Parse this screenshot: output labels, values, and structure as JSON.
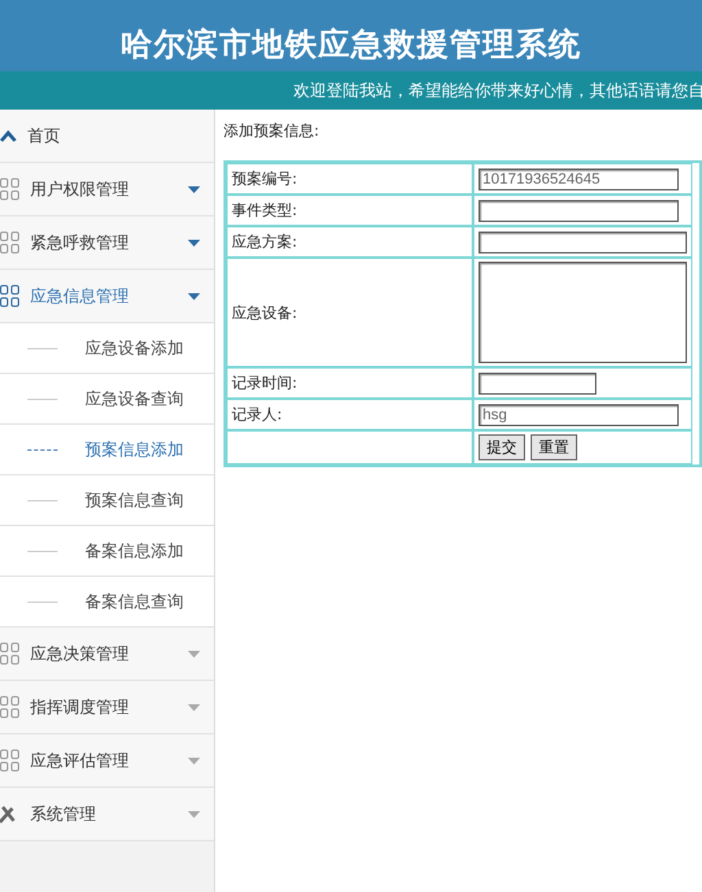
{
  "header": {
    "title": "哈尔滨市地铁应急救援管理系统",
    "welcome": "欢迎登陆我站，希望能给你带来好心情，其他话语请您自"
  },
  "sidebar": {
    "items": [
      {
        "kind": "home",
        "label": "首页",
        "selected": false
      },
      {
        "kind": "group",
        "label": "用户权限管理",
        "selected": false,
        "caret_highlighted": true
      },
      {
        "kind": "group",
        "label": "紧急呼救管理",
        "selected": false,
        "caret_highlighted": true
      },
      {
        "kind": "group",
        "label": "应急信息管理",
        "selected": true,
        "caret_highlighted": true,
        "children": [
          {
            "label": "应急设备添加",
            "selected": false
          },
          {
            "label": "应急设备查询",
            "selected": false
          },
          {
            "label": "预案信息添加",
            "selected": true
          },
          {
            "label": "预案信息查询",
            "selected": false
          },
          {
            "label": "备案信息添加",
            "selected": false
          },
          {
            "label": "备案信息查询",
            "selected": false
          }
        ]
      },
      {
        "kind": "group",
        "label": "应急决策管理",
        "selected": false,
        "caret_highlighted": false
      },
      {
        "kind": "group",
        "label": "指挥调度管理",
        "selected": false,
        "caret_highlighted": false
      },
      {
        "kind": "group",
        "label": "应急评估管理",
        "selected": false,
        "caret_highlighted": false
      },
      {
        "kind": "tools",
        "label": "系统管理",
        "selected": false,
        "caret_highlighted": false
      }
    ]
  },
  "form": {
    "title": "添加预案信息:",
    "fields": [
      {
        "kind": "text",
        "label": "预案编号:",
        "value": "10171936524645"
      },
      {
        "kind": "text",
        "label": "事件类型:"
      },
      {
        "kind": "wide",
        "label": "应急方案:"
      },
      {
        "kind": "textarea",
        "label": "应急设备:"
      },
      {
        "kind": "short",
        "label": "记录时间:"
      },
      {
        "kind": "text",
        "label": "记录人:",
        "value": "hsg"
      }
    ],
    "buttons": [
      "提交",
      "重置"
    ]
  }
}
